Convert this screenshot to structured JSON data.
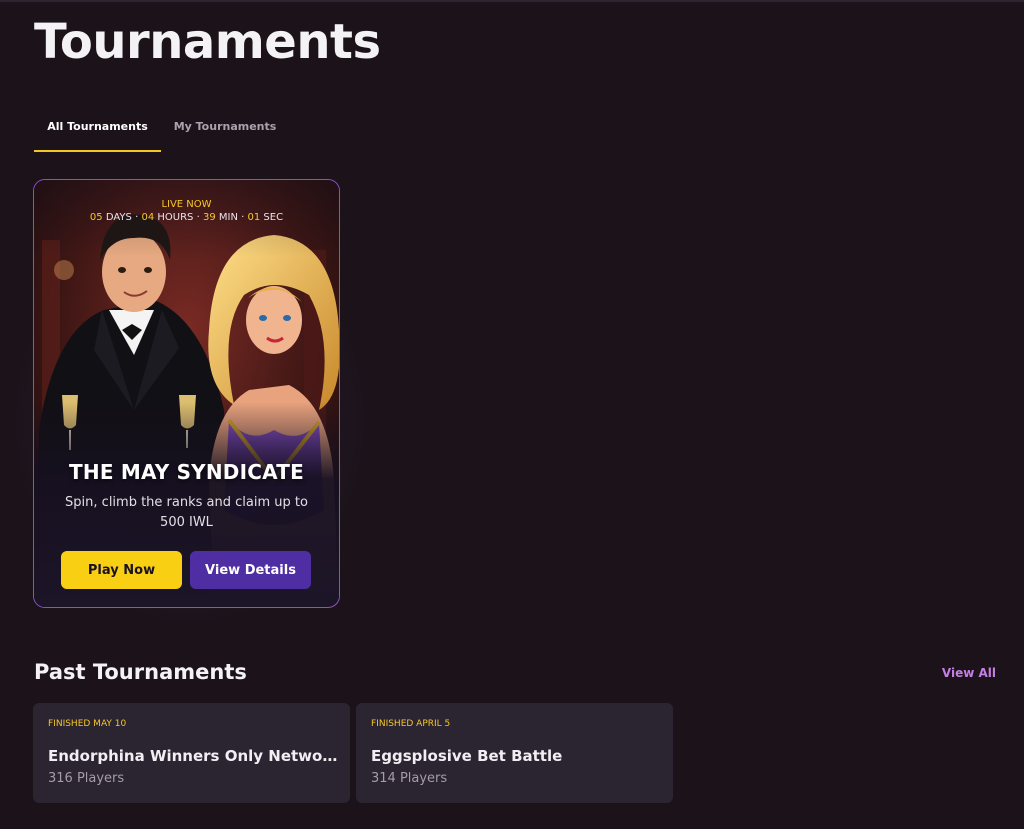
{
  "page": {
    "title": "Tournaments"
  },
  "tabs": [
    {
      "label": "All Tournaments",
      "active": true
    },
    {
      "label": "My Tournaments",
      "active": false
    }
  ],
  "featured": {
    "status": "LIVE NOW",
    "countdown": {
      "days": "05",
      "days_label": "DAYS",
      "hours": "04",
      "hours_label": "HOURS",
      "minutes": "39",
      "minutes_label": "MIN",
      "seconds": "01",
      "seconds_label": "SEC"
    },
    "title": "THE MAY SYNDICATE",
    "description": "Spin, climb the ranks and claim up to 500 IWL",
    "play_label": "Play Now",
    "details_label": "View Details"
  },
  "past": {
    "title": "Past Tournaments",
    "view_all_label": "View All",
    "items": [
      {
        "status": "FINISHED MAY 10",
        "name": "Endorphina Winners Only Networ...",
        "players": "316 Players"
      },
      {
        "status": "FINISHED APRIL 5",
        "name": "Eggsplosive Bet Battle",
        "players": "314 Players"
      }
    ]
  },
  "colors": {
    "accent_yellow": "#f9cf14",
    "accent_purple": "#4f2ea3",
    "card_border": "#8b4fd6",
    "link_purple": "#c47ee6"
  }
}
